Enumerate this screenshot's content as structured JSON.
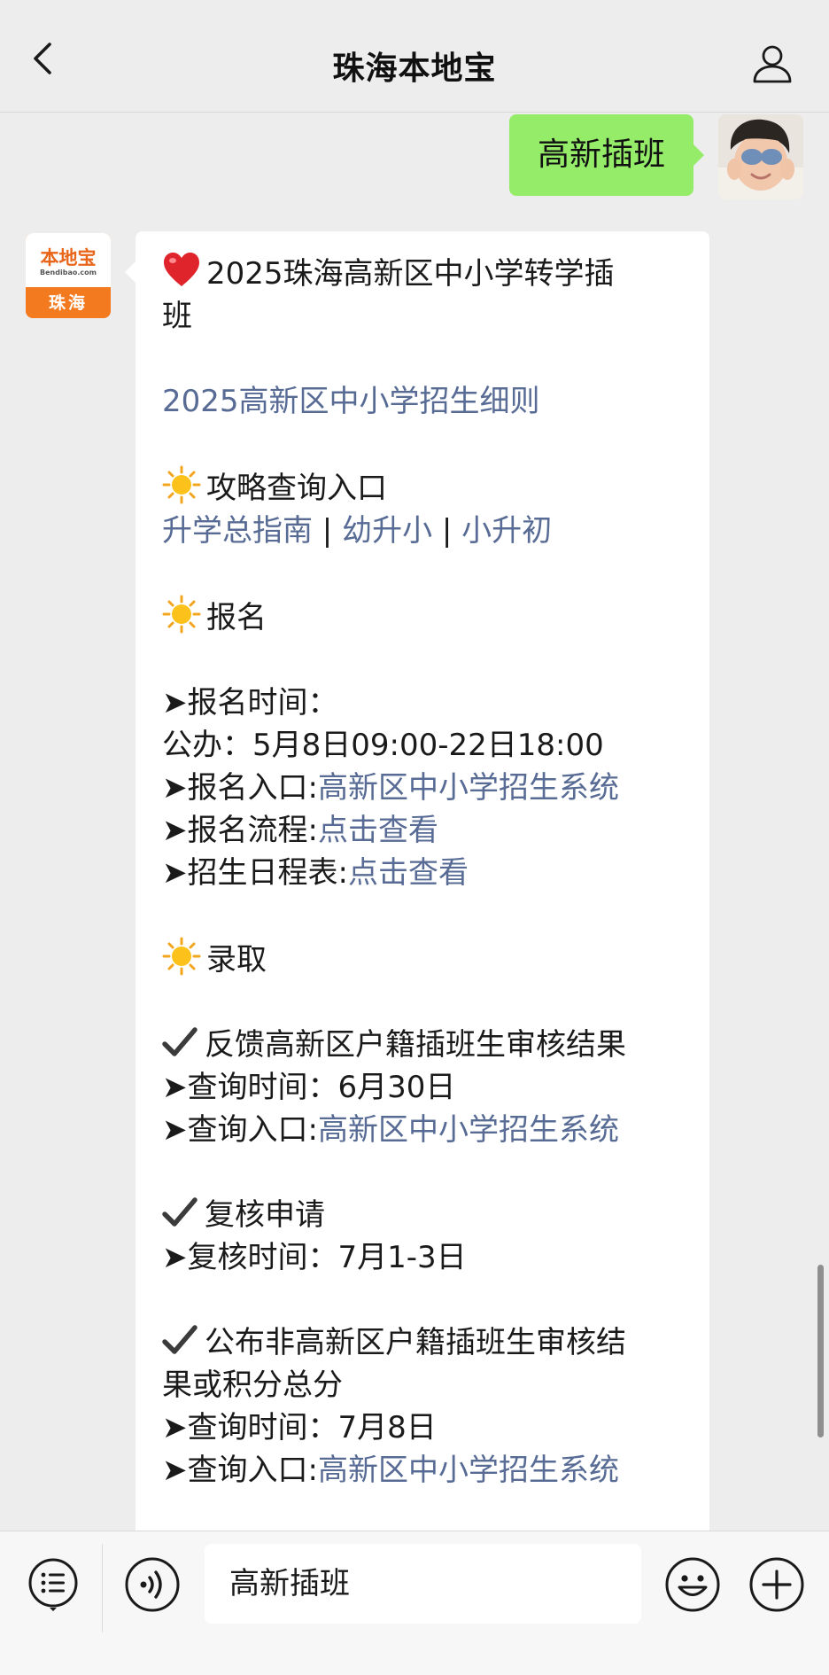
{
  "nav": {
    "title": "珠海本地宝",
    "back_icon": "chevron-left-icon",
    "profile_icon": "user-icon"
  },
  "chat": {
    "outgoing": {
      "text": "高新插班"
    },
    "bot_avatar": {
      "brand": "本地宝",
      "url": "Bendibao.com",
      "city": "珠海"
    },
    "reply": {
      "title": "2025珠海高新区中小学转学插",
      "title_cont": "班",
      "rules_link": "2025高新区中小学招生细则",
      "guide": {
        "heading": "攻略查询入口",
        "links": [
          "升学总指南",
          "幼升小",
          "小升初"
        ],
        "sep": " | "
      },
      "signup": {
        "heading": "报名",
        "time_label": "➤报名时间：",
        "public_time": "公办：5月8日09:00-22日18:00",
        "entry_label": "➤报名入口:",
        "entry_link": "高新区中小学招生系统",
        "flow_label": "➤报名流程:",
        "flow_link": "点击查看",
        "schedule_label": "➤招生日程表:",
        "schedule_link": "点击查看"
      },
      "admission": {
        "heading": "录取",
        "feedback": {
          "title": "反馈高新区户籍插班生审核结果",
          "time": "➤查询时间：6月30日",
          "entry_label": "➤查询入口:",
          "entry_link": "高新区中小学招生系统"
        },
        "review": {
          "title": "复核申请",
          "time": "➤复核时间：7月1-3日"
        },
        "nonlocal": {
          "title": "公布非高新区户籍插班生审核结",
          "title_cont": "果或积分总分",
          "time": "➤查询时间：7月8日",
          "entry_label": "➤查询入口:",
          "entry_link": "高新区中小学招生系统"
        }
      }
    }
  },
  "input_bar": {
    "value": "高新插班",
    "menu_icon": "menu-list-icon",
    "voice_icon": "voice-icon",
    "emoji_icon": "emoji-icon",
    "plus_icon": "plus-icon"
  },
  "colors": {
    "outgoing_bubble": "#95ec69",
    "link": "#576b95",
    "brand_orange": "#f47a20"
  }
}
